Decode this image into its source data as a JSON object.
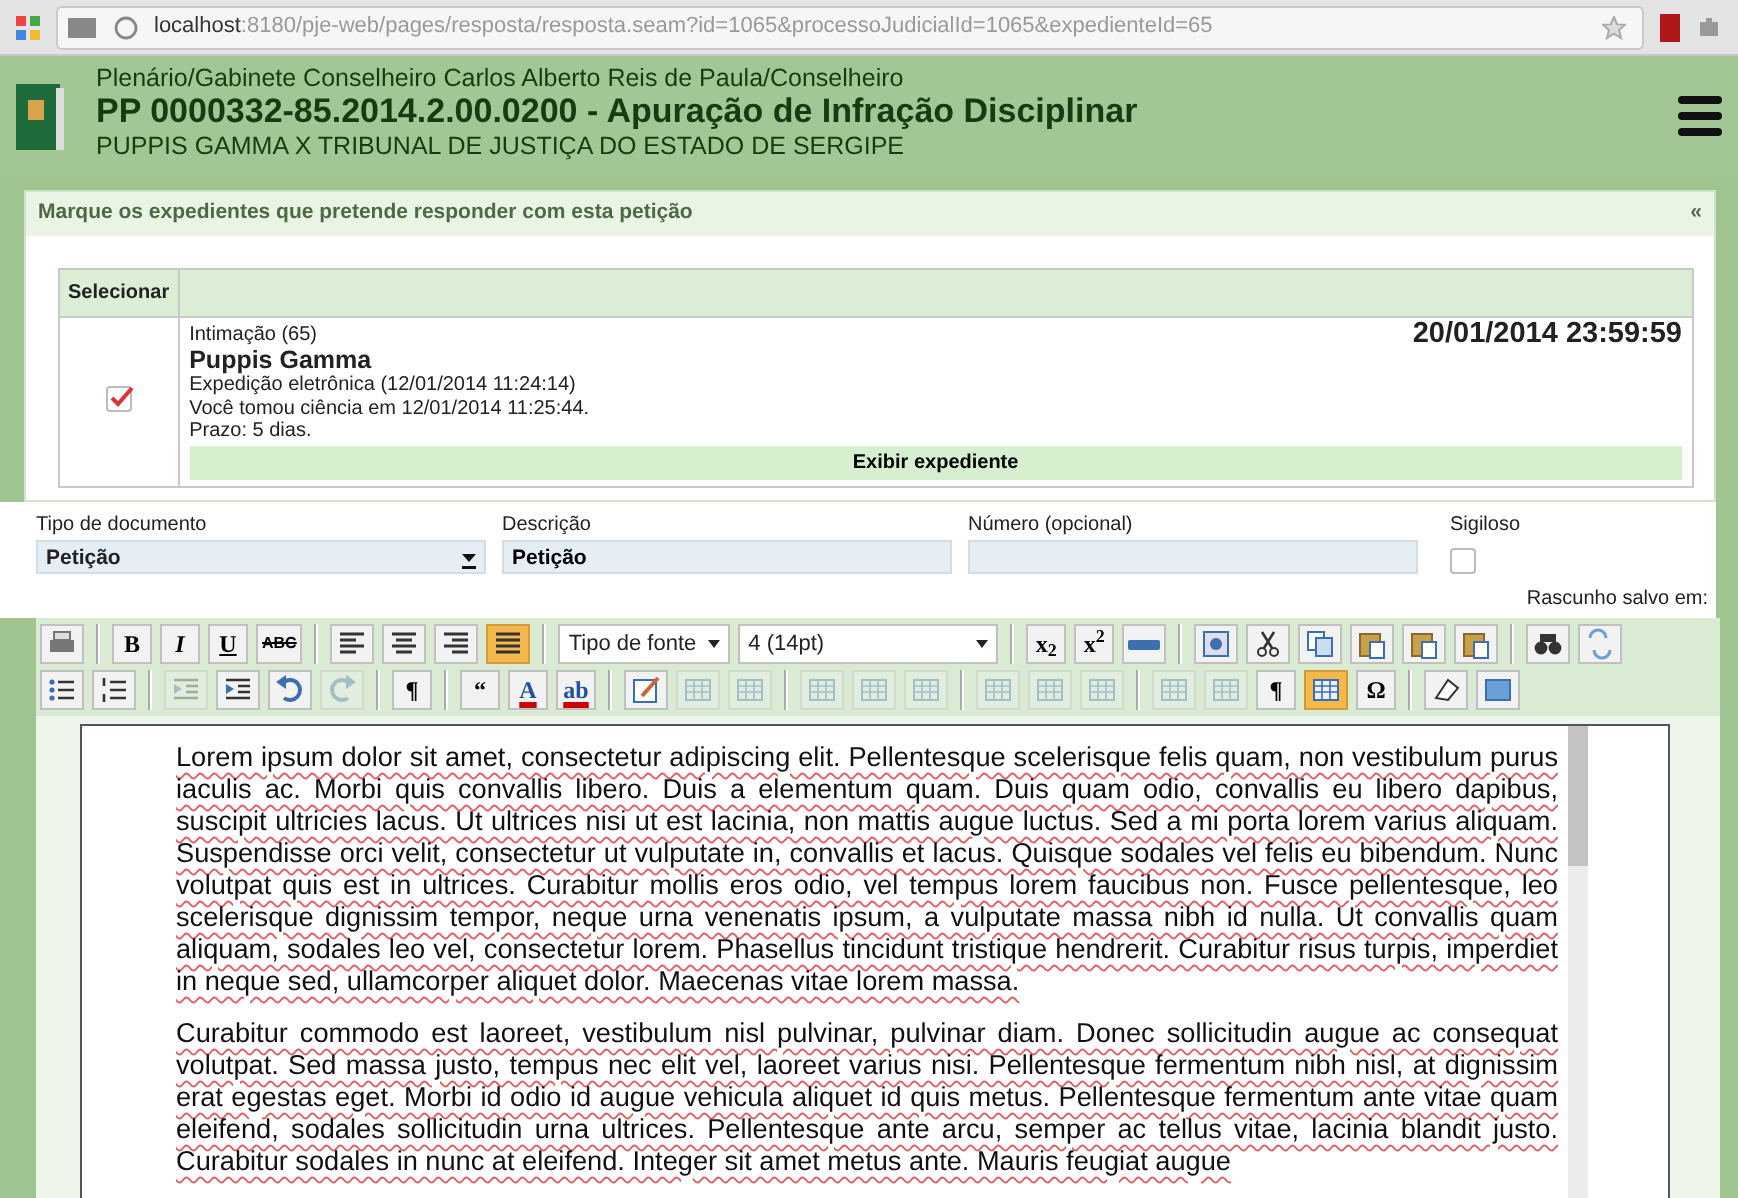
{
  "browser": {
    "url_host": "localhost",
    "url_rest": ":8180/pje-web/pages/resposta/resposta.seam?id=1065&processoJudicialId=1065&expedienteId=65"
  },
  "header": {
    "office": "Plenário/Gabinete Conselheiro Carlos Alberto Reis de Paula/Conselheiro",
    "title": "PP 0000332-85.2014.2.00.0200 - Apuração de Infração Disciplinar",
    "parties": "PUPPIS GAMMA X TRIBUNAL DE JUSTIÇA DO ESTADO DE SERGIPE"
  },
  "panel": {
    "title": "Marque os expedientes que pretende responder com esta petição",
    "collapse": "«",
    "columns": [
      "Selecionar"
    ],
    "rows": [
      {
        "checked": true,
        "type": "Intimação (65)",
        "name": "Puppis Gamma",
        "lines": [
          "Expedição eletrônica (12/01/2014 11:24:14)",
          "Você tomou ciência em 12/01/2014 11:25:44.",
          "Prazo: 5 dias."
        ],
        "deadline": "20/01/2014 23:59:59",
        "action": "Exibir expediente"
      }
    ]
  },
  "form": {
    "document_type": {
      "label": "Tipo de documento",
      "value": "Petição"
    },
    "description": {
      "label": "Descrição",
      "value": "Petição"
    },
    "number": {
      "label": "Número (opcional)"
    },
    "confidential": {
      "label": "Sigiloso",
      "checked": false
    },
    "draft_status": "Rascunho salvo em:"
  },
  "toolbar": [
    [
      {
        "kind": "print"
      },
      {
        "kind": "sep"
      },
      {
        "kind": "bold",
        "label": "B"
      },
      {
        "kind": "italic",
        "label": "I"
      },
      {
        "kind": "underline",
        "label": "U"
      },
      {
        "kind": "strike",
        "label": "ABC"
      },
      {
        "kind": "sep"
      },
      {
        "kind": "alignleft"
      },
      {
        "kind": "aligncenter"
      },
      {
        "kind": "alignright"
      },
      {
        "kind": "justify",
        "selected": true
      },
      {
        "kind": "sep"
      },
      {
        "kind": "select",
        "label": "Tipo de fonte"
      },
      {
        "kind": "selectwide",
        "label": "4 (14pt)"
      },
      {
        "kind": "sep"
      },
      {
        "kind": "bold",
        "label": "x$_{2}$"
      },
      {
        "kind": "bold",
        "label": "x$^{2}$"
      },
      {
        "kind": "hr"
      },
      {
        "kind": "sep"
      },
      {
        "kind": "styleprops"
      },
      {
        "kind": "cut"
      },
      {
        "kind": "copy"
      },
      {
        "kind": "paste"
      },
      {
        "kind": "pastetext"
      },
      {
        "kind": "pasteword"
      },
      {
        "kind": "sep"
      },
      {
        "kind": "find"
      },
      {
        "kind": "replace"
      }
    ],
    [
      {
        "kind": "bullist"
      },
      {
        "kind": "numlist"
      },
      {
        "kind": "sep"
      },
      {
        "kind": "outdent",
        "disabled": true
      },
      {
        "kind": "indent"
      },
      {
        "kind": "undo"
      },
      {
        "kind": "redo",
        "disabled": true
      },
      {
        "kind": "sep"
      },
      {
        "kind": "bold",
        "label": "¶"
      },
      {
        "kind": "sep"
      },
      {
        "kind": "bold",
        "label": "“"
      },
      {
        "kind": "color",
        "label": "A"
      },
      {
        "kind": "color",
        "label": "ab"
      },
      {
        "kind": "sep"
      },
      {
        "kind": "edit"
      },
      {
        "kind": "table",
        "disabled": true
      },
      {
        "kind": "table",
        "disabled": true
      },
      {
        "kind": "sep"
      },
      {
        "kind": "table",
        "disabled": true
      },
      {
        "kind": "table",
        "disabled": true
      },
      {
        "kind": "table",
        "disabled": true
      },
      {
        "kind": "sep"
      },
      {
        "kind": "table",
        "disabled": true
      },
      {
        "kind": "table",
        "disabled": true
      },
      {
        "kind": "table",
        "disabled": true
      },
      {
        "kind": "sep"
      },
      {
        "kind": "table",
        "disabled": true
      },
      {
        "kind": "table",
        "disabled": true
      },
      {
        "kind": "bold",
        "label": "¶"
      },
      {
        "kind": "table",
        "selected": true
      },
      {
        "kind": "bold",
        "label": "Ω"
      },
      {
        "kind": "sep"
      },
      {
        "kind": "eraser"
      },
      {
        "kind": "fullscreen"
      }
    ]
  ],
  "document": {
    "paragraphs": [
      "Lorem ipsum dolor sit amet, consectetur adipiscing elit. Pellentesque scelerisque felis quam, non vestibulum purus iaculis ac. Morbi quis convallis libero. Duis a elementum quam. Duis quam odio, convallis eu libero dapibus, suscipit ultricies lacus. Ut ultrices nisi ut est lacinia, non mattis augue luctus. Sed a mi porta lorem varius aliquam. Suspendisse orci velit, consectetur ut vulputate in, convallis et lacus. Quisque sodales vel felis eu bibendum. Nunc volutpat quis est in ultrices. Curabitur mollis eros odio, vel tempus lorem faucibus non. Fusce pellentesque, leo scelerisque dignissim tempor, neque urna venenatis ipsum, a vulputate massa nibh id nulla. Ut convallis quam aliquam, sodales leo vel, consectetur lorem. Phasellus tincidunt tristique hendrerit. Curabitur risus turpis, imperdiet in neque sed, ullamcorper aliquet dolor. Maecenas vitae lorem massa.",
      "Curabitur commodo est laoreet, vestibulum nisl pulvinar, pulvinar diam. Donec sollicitudin augue ac consequat volutpat. Sed massa justo, tempus nec elit vel, laoreet varius nisi. Pellentesque fermentum nibh nisl, at dignissim erat egestas eget. Morbi id odio id augue vehicula aliquet id quis metus. Pellentesque fermentum ante vitae quam eleifend, sodales sollicitudin urna ultrices. Pellentesque ante arcu, semper ac tellus vitae, lacinia blandit justo. Curabitur sodales in nunc at eleifend. Integer sit amet metus ante. Mauris feugiat augue"
    ]
  }
}
